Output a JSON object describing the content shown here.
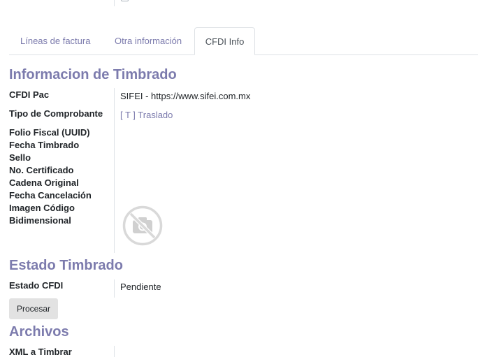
{
  "tabs": [
    {
      "label": "Líneas de factura"
    },
    {
      "label": "Otra información"
    },
    {
      "label": "CFDI Info"
    }
  ],
  "timbrado": {
    "title": "Informacion de Timbrado",
    "cfdi_pac_label": "CFDI Pac",
    "cfdi_pac_value": "SIFEI - https://www.sifei.com.mx",
    "tipo_label": "Tipo de Comprobante",
    "tipo_value": "[ T ] Traslado",
    "folio_label": "Folio Fiscal (UUID)",
    "fecha_timbrado_label": "Fecha Timbrado",
    "sello_label": "Sello",
    "certificado_label": "No. Certificado",
    "cadena_label": "Cadena Original",
    "fecha_cancelacion_label": "Fecha Cancelación",
    "imagen_label_1": "Imagen Código",
    "imagen_label_2": "Bidimensional"
  },
  "estado": {
    "title": "Estado Timbrado",
    "estado_label": "Estado CFDI",
    "estado_value": "Pendiente",
    "procesar_button": "Procesar"
  },
  "archivos": {
    "title": "Archivos",
    "xml_label": "XML a Timbrar"
  },
  "colors": {
    "accent": "#7c7bad",
    "button_bg": "#e2e2e2",
    "border": "#dee2e6"
  }
}
